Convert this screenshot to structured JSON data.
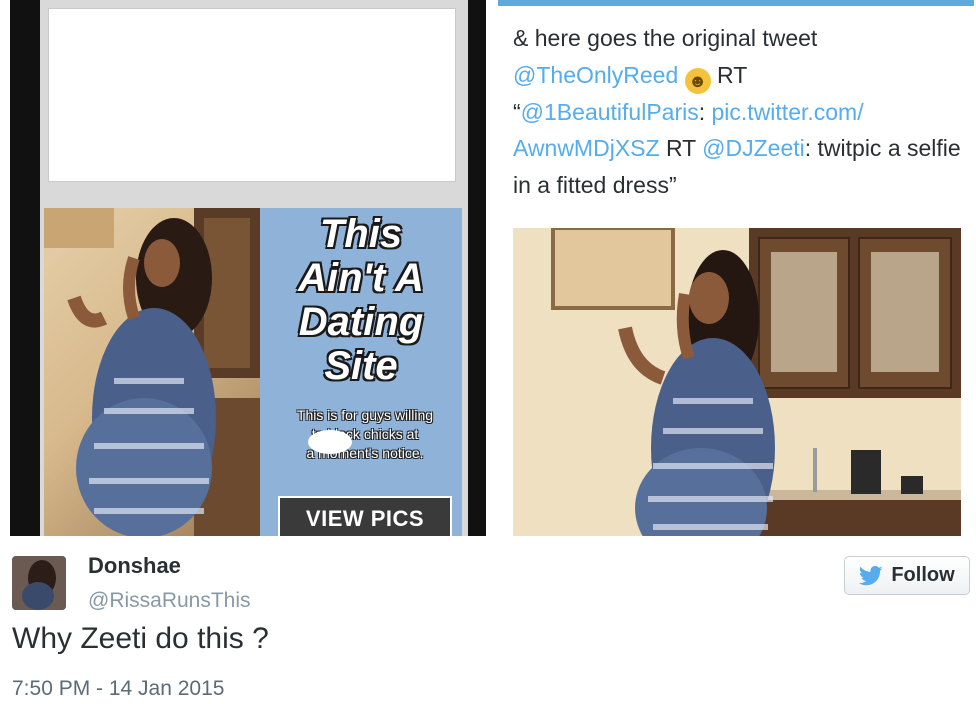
{
  "left_ad": {
    "headline_lines": [
      "This",
      "Ain't A",
      "Dating",
      "Site"
    ],
    "subtext_lines": [
      "This is for guys willing",
      "to      black chicks at",
      "a moment's notice."
    ],
    "button_label": "VIEW PICS"
  },
  "quoted_tweet": {
    "line1": "& here goes the original tweet",
    "mention_reed": "@TheOnlyReed",
    "rt1": "RT",
    "open_quote": "“",
    "mention_paris": "@1BeautifulParis",
    "colon1": ":",
    "link_part1": "pic.twitter.com/",
    "link_part2": "AwnwMDjXSZ",
    "rt2": "RT",
    "mention_zeeti": "@DJZeeti",
    "text_end": ": twitpic a selfie in a fitted dress”",
    "emoji": "laughing-tears-emoji"
  },
  "tweet": {
    "display_name": "Donshae",
    "handle": "@RissaRunsThis",
    "follow_label": "Follow",
    "text": "Why Zeeti do this ?",
    "timestamp": "7:50 PM - 14 Jan 2015"
  },
  "colors": {
    "link_blue": "#55acee",
    "twitter_bird": "#55acee",
    "ad_blue": "#8fb2d9",
    "text_dark": "#292f33",
    "text_gray": "#8899a6"
  },
  "icons": {
    "follow_icon": "twitter-bird-icon"
  }
}
